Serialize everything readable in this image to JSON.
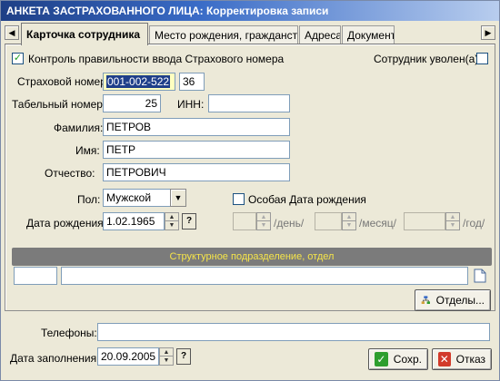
{
  "window": {
    "title": "АНКЕТА ЗАСТРАХОВАННОГО ЛИЦА: Корректировка записи"
  },
  "tabs": [
    {
      "label": "Карточка сотрудника",
      "active": true
    },
    {
      "label": "Место рождения, гражданство",
      "active": false
    },
    {
      "label": "Адреса",
      "active": false
    },
    {
      "label": "Документ",
      "active": false
    }
  ],
  "tab_nav": {
    "prev_glyph": "◀",
    "next_glyph": "▶"
  },
  "form": {
    "validate_checkbox": {
      "label": "Контроль правильности ввода Страхового номера",
      "checked": true
    },
    "fired_checkbox": {
      "label": "Сотрудник уволен(а)",
      "checked": false
    },
    "insurance_number": {
      "label": "Страховой номер:",
      "value": "001-002-522",
      "control_digits": "36"
    },
    "personnel_number": {
      "label": "Табельный номер:",
      "value": "25"
    },
    "inn": {
      "label": "ИНН:",
      "value": ""
    },
    "last_name": {
      "label": "Фамилия:",
      "value": "ПЕТРОВ"
    },
    "first_name": {
      "label": "Имя:",
      "value": "ПЕТР"
    },
    "patronymic": {
      "label": "Отчество:",
      "value": "ПЕТРОВИЧ"
    },
    "gender": {
      "label": "Пол:",
      "value": "Мужской"
    },
    "special_birthdate": {
      "label": "Особая Дата рождения",
      "checked": false
    },
    "birth_date": {
      "label": "Дата рождения:",
      "value": "1.02.1965"
    },
    "special_day_label": "/день/",
    "special_month_label": "/месяц/",
    "special_year_label": "/год/",
    "division": {
      "header": "Структурное подразделение, отдел",
      "code": "",
      "name": ""
    },
    "departments_button": "Отделы...",
    "phones": {
      "label": "Телефоны:",
      "value": ""
    },
    "fill_date": {
      "label": "Дата заполнения:",
      "value": "20.09.2005"
    },
    "save_button": "Сохр.",
    "cancel_button": "Отказ",
    "calendar_glyph": "?",
    "check_glyph": "✓"
  },
  "colors": {
    "highlight_field": "#ffffc0",
    "section_bar": "#7b7b7b",
    "section_text": "#f5e44a",
    "save_icon": "#2e9e2e",
    "cancel_icon": "#d23a2a"
  }
}
